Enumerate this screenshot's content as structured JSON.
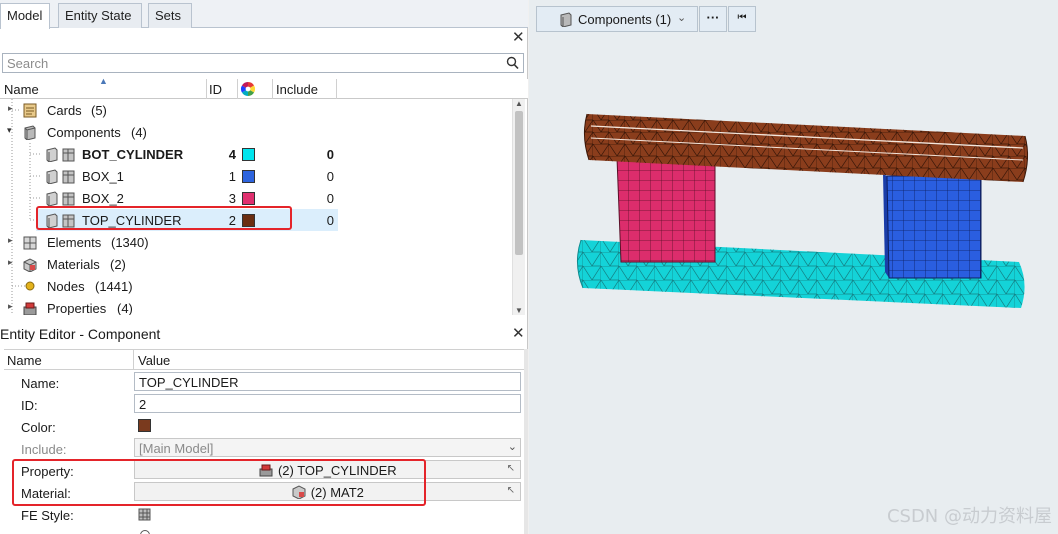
{
  "tabs": [
    {
      "label": "Model"
    },
    {
      "label": "Entity State"
    },
    {
      "label": "Sets"
    }
  ],
  "search": {
    "placeholder": "Search"
  },
  "columns": {
    "name": "Name",
    "id": "ID",
    "include": "Include"
  },
  "tree": {
    "cards": {
      "label": "Cards",
      "count": "(5)"
    },
    "components": {
      "label": "Components",
      "count": "(4)"
    },
    "items": [
      {
        "label": "BOT_CYLINDER",
        "id": "4",
        "color": "#00e5ee",
        "include": "0"
      },
      {
        "label": "BOX_1",
        "id": "1",
        "color": "#2d64de",
        "include": "0"
      },
      {
        "label": "BOX_2",
        "id": "3",
        "color": "#e0306f",
        "include": "0"
      },
      {
        "label": "TOP_CYLINDER",
        "id": "2",
        "color": "#6b2e12",
        "include": "0"
      }
    ],
    "elements": {
      "label": "Elements",
      "count": "(1340)"
    },
    "materials": {
      "label": "Materials",
      "count": "(2)"
    },
    "nodes": {
      "label": "Nodes",
      "count": "(1441)"
    },
    "properties": {
      "label": "Properties",
      "count": "(4)"
    }
  },
  "editor": {
    "title": "Entity Editor - Component",
    "col_name": "Name",
    "col_value": "Value",
    "name_label": "Name:",
    "name_value": "TOP_CYLINDER",
    "id_label": "ID:",
    "id_value": "2",
    "color_label": "Color:",
    "color_value": "#7a3a1e",
    "include_label": "Include:",
    "include_value": "[Main Model]",
    "property_label": "Property:",
    "property_value": "(2) TOP_CYLINDER",
    "material_label": "Material:",
    "material_value": "(2) MAT2",
    "festyle_label": "FE Style:"
  },
  "viewport": {
    "components_button": "Components (1)",
    "more_button": "···",
    "watermark": "CSDN @动力资料屋"
  }
}
